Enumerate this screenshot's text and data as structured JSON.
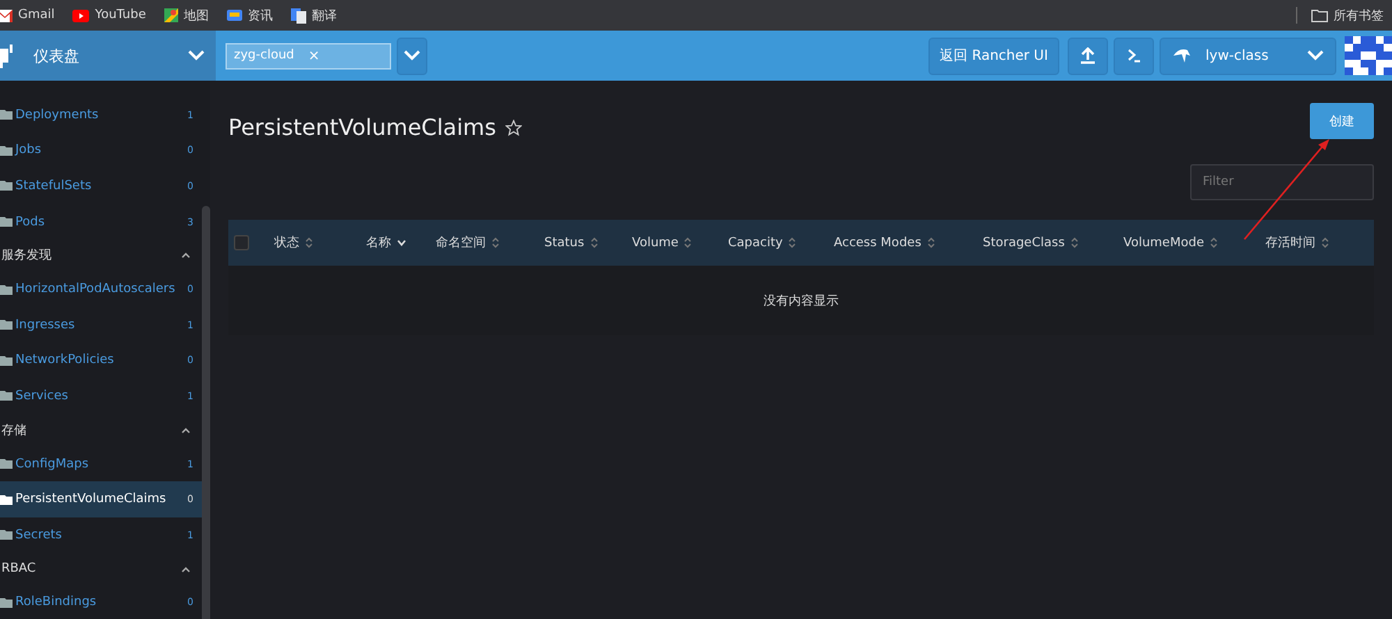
{
  "bookmarks": [
    {
      "kind": "gmail",
      "label": "Gmail"
    },
    {
      "kind": "youtube",
      "label": "YouTube"
    },
    {
      "kind": "maps",
      "label": "地图"
    },
    {
      "kind": "news",
      "label": "资讯"
    },
    {
      "kind": "translate",
      "label": "翻译"
    }
  ],
  "all_bookmarks": "所有书签",
  "header": {
    "dashboard": "仪表盘",
    "namespace_tag": "zyg-cloud",
    "namespace_remove": "×",
    "back_button": "返回 Rancher UI",
    "cluster": "lyw-class"
  },
  "sidebar": {
    "sections": [
      {
        "items": [
          {
            "label": "Deployments",
            "count": "1",
            "selected": false
          },
          {
            "label": "Jobs",
            "count": "0",
            "selected": false
          },
          {
            "label": "StatefulSets",
            "count": "0",
            "selected": false
          },
          {
            "label": "Pods",
            "count": "3",
            "selected": false
          }
        ]
      },
      {
        "title": "服务发现",
        "expanded": true,
        "items": [
          {
            "label": "HorizontalPodAutoscalers",
            "count": "0",
            "selected": false
          },
          {
            "label": "Ingresses",
            "count": "1",
            "selected": false
          },
          {
            "label": "NetworkPolicies",
            "count": "0",
            "selected": false
          },
          {
            "label": "Services",
            "count": "1",
            "selected": false
          }
        ]
      },
      {
        "title": "存储",
        "expanded": true,
        "items": [
          {
            "label": "ConfigMaps",
            "count": "1",
            "selected": false
          },
          {
            "label": "PersistentVolumeClaims",
            "count": "0",
            "selected": true
          },
          {
            "label": "Secrets",
            "count": "1",
            "selected": false
          }
        ]
      },
      {
        "title": "RBAC",
        "expanded": true,
        "items": [
          {
            "label": "RoleBindings",
            "count": "0",
            "selected": false
          }
        ]
      }
    ]
  },
  "page": {
    "title": "PersistentVolumeClaims",
    "favorite": false,
    "create_button": "创建",
    "filter": {
      "placeholder": "Filter"
    }
  },
  "table": {
    "columns": [
      {
        "label": "状态",
        "sorted": false
      },
      {
        "label": "名称",
        "sorted": true
      },
      {
        "label": "命名空间",
        "sorted": false
      },
      {
        "label": "Status",
        "sorted": false
      },
      {
        "label": "Volume",
        "sorted": false
      },
      {
        "label": "Capacity",
        "sorted": false
      },
      {
        "label": "Access Modes",
        "sorted": false
      },
      {
        "label": "StorageClass",
        "sorted": false
      },
      {
        "label": "VolumeMode",
        "sorted": false
      },
      {
        "label": "存活时间",
        "sorted": false
      }
    ],
    "select_all": false,
    "empty_message": "没有内容显示"
  }
}
